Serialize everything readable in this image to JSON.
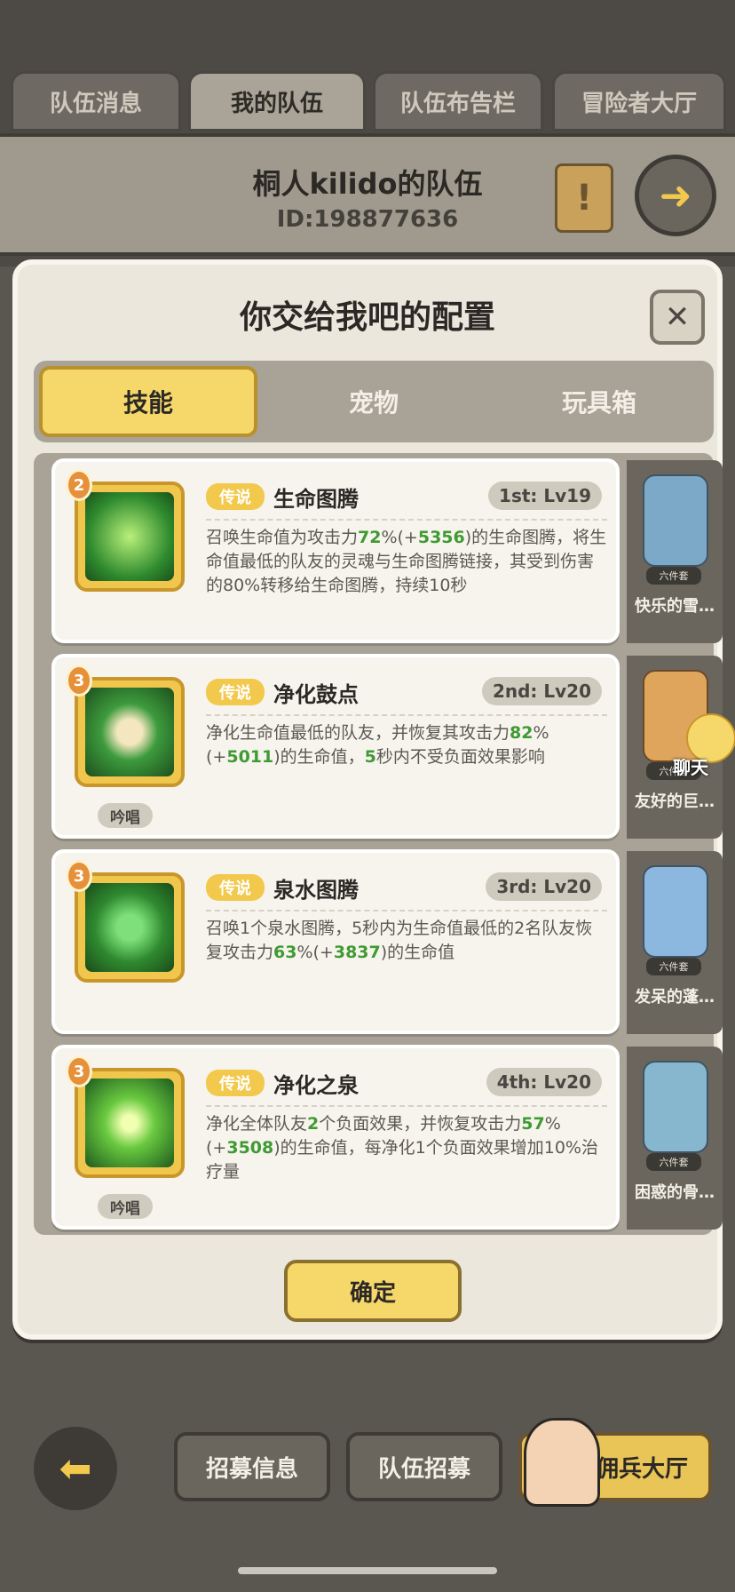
{
  "top_tabs": [
    "队伍消息",
    "我的队伍",
    "队伍布告栏",
    "冒险者大厅"
  ],
  "active_top_tab": 1,
  "team": {
    "name": "桐人kilido的队伍",
    "id": "ID:198877636",
    "notice_icon": "!",
    "exit_icon": "exit-arrow"
  },
  "modal": {
    "title": "你交给我吧的配置",
    "close": "✕",
    "tabs": [
      "技能",
      "宠物",
      "玩具箱"
    ],
    "active_tab": 0,
    "confirm": "确定"
  },
  "skills": [
    {
      "level": "2",
      "rarity": "传说",
      "name": "生命图腾",
      "slot": "1st: Lv19",
      "desc_parts": [
        "召唤生命值为攻击力",
        "72",
        "%(+",
        "5356",
        ")的生命图腾，将生命值最低的队友的灵魂与生命图腾链接，其受到伤害的80%转移给生命图腾，持续10秒"
      ],
      "chant": ""
    },
    {
      "level": "3",
      "rarity": "传说",
      "name": "净化鼓点",
      "slot": "2nd: Lv20",
      "desc_parts": [
        "净化生命值最低的队友，并恢复其攻击力",
        "82",
        "%(+",
        "5011",
        ")的生命值，",
        "5",
        "秒内不受负面效果影响"
      ],
      "chant": "吟唱"
    },
    {
      "level": "3",
      "rarity": "传说",
      "name": "泉水图腾",
      "slot": "3rd: Lv20",
      "desc_parts": [
        "召唤1个泉水图腾，5秒内为生命值最低的2名队友恢复攻击力",
        "63",
        "%(+",
        "3837",
        ")的生命值"
      ],
      "chant": ""
    },
    {
      "level": "3",
      "rarity": "传说",
      "name": "净化之泉",
      "slot": "4th: Lv20",
      "desc_parts": [
        "净化全体队友",
        "2",
        "个负面效果，并恢复攻击力",
        "57",
        "%(+",
        "3508",
        ")的生命值，每净化1个负面效果增加10%治疗量"
      ],
      "chant": "吟唱"
    }
  ],
  "pets": [
    {
      "badge": "六件套",
      "name": "快乐的雪…",
      "color": "#7db7d9"
    },
    {
      "badge": "六件套",
      "name": "友好的巨…",
      "color": "#e0a55c"
    },
    {
      "badge": "六件套",
      "name": "发呆的蓬…",
      "color": "#8cb8e0"
    },
    {
      "badge": "六件套",
      "name": "困惑的骨…",
      "color": "#86b7cf"
    }
  ],
  "chat": {
    "label": "聊天"
  },
  "bottom": {
    "back_icon": "back-arrow",
    "buttons": [
      "招募信息",
      "队伍招募",
      "佣兵大厅"
    ]
  }
}
